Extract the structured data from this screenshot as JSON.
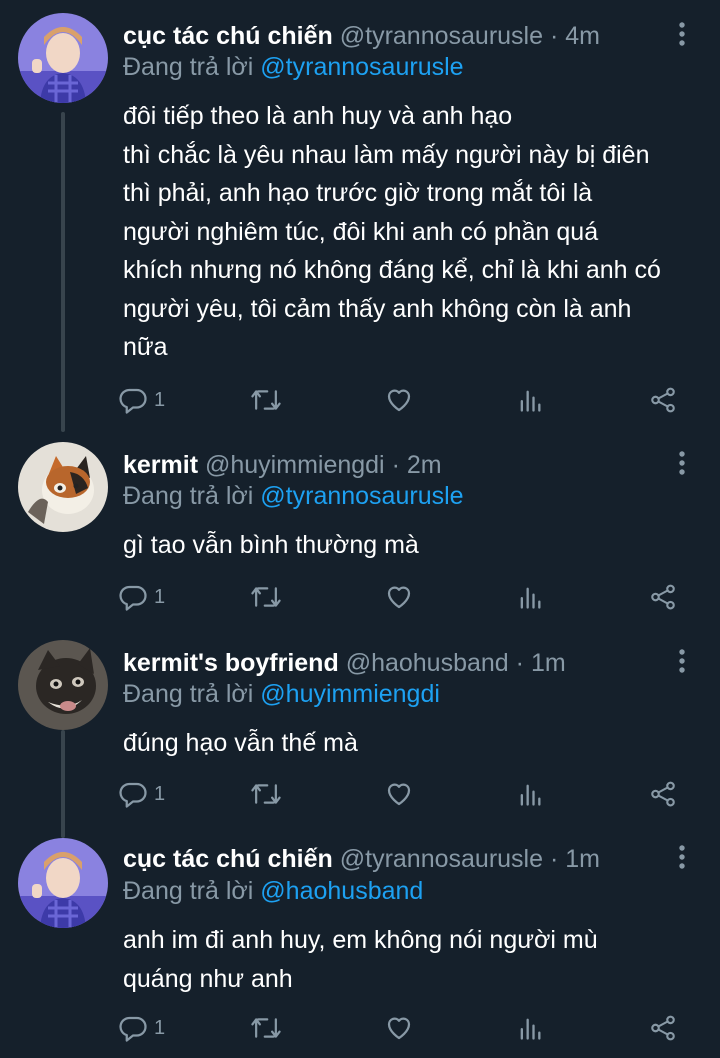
{
  "tweets": [
    {
      "display_name": "cục tác chú chiến",
      "handle": "@tyrannosaurusle",
      "time": "4m",
      "reply_prefix": "Đang trả lời",
      "reply_to": "@tyrannosaurusle",
      "lines": [
        "đôi tiếp theo là anh huy và anh hạo",
        "thì chắc là yêu nhau làm mấy người này bị điên",
        "thì phải, anh hạo trước giờ trong mắt tôi là",
        "người nghiêm túc, đôi khi anh có phần quá",
        "khích nhưng nó không đáng kể, chỉ là khi anh có",
        "người yêu, tôi cảm thấy anh không còn là anh",
        "nữa"
      ],
      "reply_count": "1"
    },
    {
      "display_name": "kermit",
      "handle": "@huyimmiengdi",
      "time": "2m",
      "reply_prefix": "Đang trả lời",
      "reply_to": "@tyrannosaurusle",
      "lines": [
        "gì tao vẫn bình thường mà"
      ],
      "reply_count": "1"
    },
    {
      "display_name": "kermit's boyfriend",
      "handle": "@haohusband",
      "time": "1m",
      "reply_prefix": "Đang trả lời",
      "reply_to": "@huyimmiengdi",
      "lines": [
        "đúng hạo vẫn thế mà"
      ],
      "reply_count": "1"
    },
    {
      "display_name": "cục tác chú chiến",
      "handle": "@tyrannosaurusle",
      "time": "1m",
      "reply_prefix": "Đang trả lời",
      "reply_to": "@haohusband",
      "lines": [
        "anh im đi anh huy, em không nói người mù",
        "quáng như anh"
      ],
      "reply_count": "1"
    }
  ],
  "sep": "·",
  "colors": {
    "background": "#15202b",
    "text_primary": "#ffffff",
    "text_secondary": "#8899a6",
    "link": "#1da1f2",
    "thread_line": "#38444d"
  },
  "icons": [
    "reply-icon",
    "retweet-icon",
    "like-icon",
    "analytics-icon",
    "share-icon",
    "more-icon"
  ]
}
